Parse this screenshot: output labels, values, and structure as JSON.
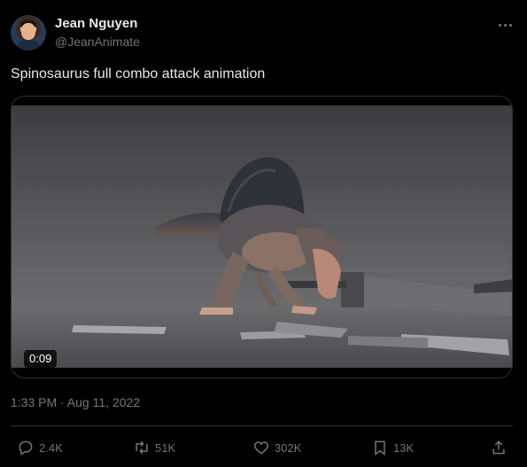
{
  "author": {
    "name": "Jean Nguyen",
    "handle": "@JeanAnimate"
  },
  "tweet": {
    "text": "Spinosaurus full combo attack animation",
    "timestamp": "1:33 PM · Aug 11, 2022"
  },
  "media": {
    "duration": "0:09"
  },
  "actions": {
    "replies": "2.4K",
    "retweets": "51K",
    "likes": "302K",
    "bookmarks": "13K"
  },
  "icons": {
    "more": "more-icon",
    "reply": "reply-icon",
    "retweet": "retweet-icon",
    "like": "heart-icon",
    "bookmark": "bookmark-icon",
    "share": "share-icon"
  },
  "colors": {
    "background": "#000000",
    "text_primary": "#e7e9ea",
    "text_secondary": "#71767b",
    "border": "#2f3336"
  }
}
